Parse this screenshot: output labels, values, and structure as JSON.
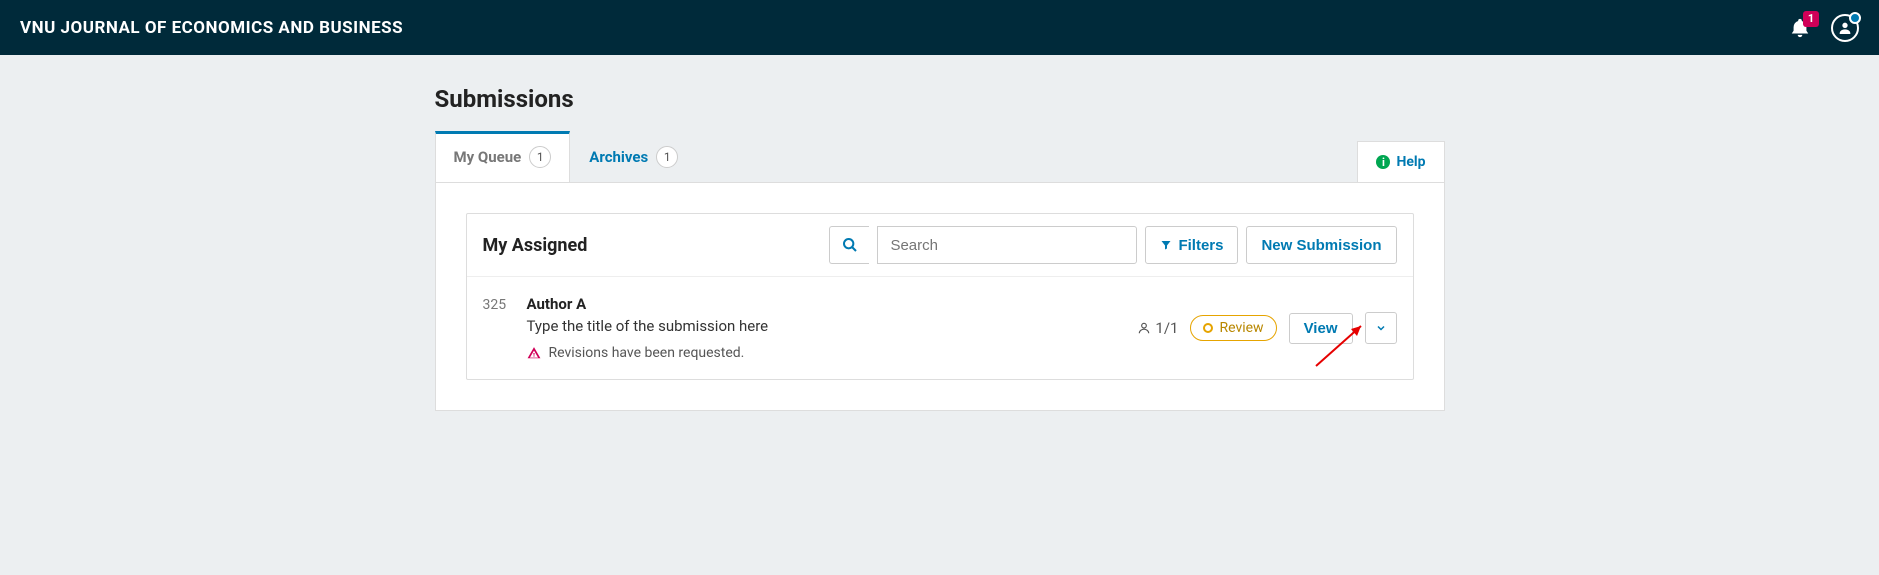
{
  "navbar": {
    "title": "VNU JOURNAL OF ECONOMICS AND BUSINESS",
    "notification_count": "1"
  },
  "page": {
    "title": "Submissions"
  },
  "tabs": {
    "my_queue": {
      "label": "My Queue",
      "count": "1"
    },
    "archives": {
      "label": "Archives",
      "count": "1"
    },
    "help": {
      "label": "Help"
    }
  },
  "list": {
    "title": "My Assigned",
    "search_placeholder": "Search",
    "filters_label": "Filters",
    "new_submission_label": "New Submission"
  },
  "submission": {
    "id": "325",
    "author": "Author A",
    "title": "Type the title of the submission here",
    "notice": "Revisions have been requested.",
    "reviewers": "1/1",
    "stage": "Review",
    "view_label": "View"
  }
}
